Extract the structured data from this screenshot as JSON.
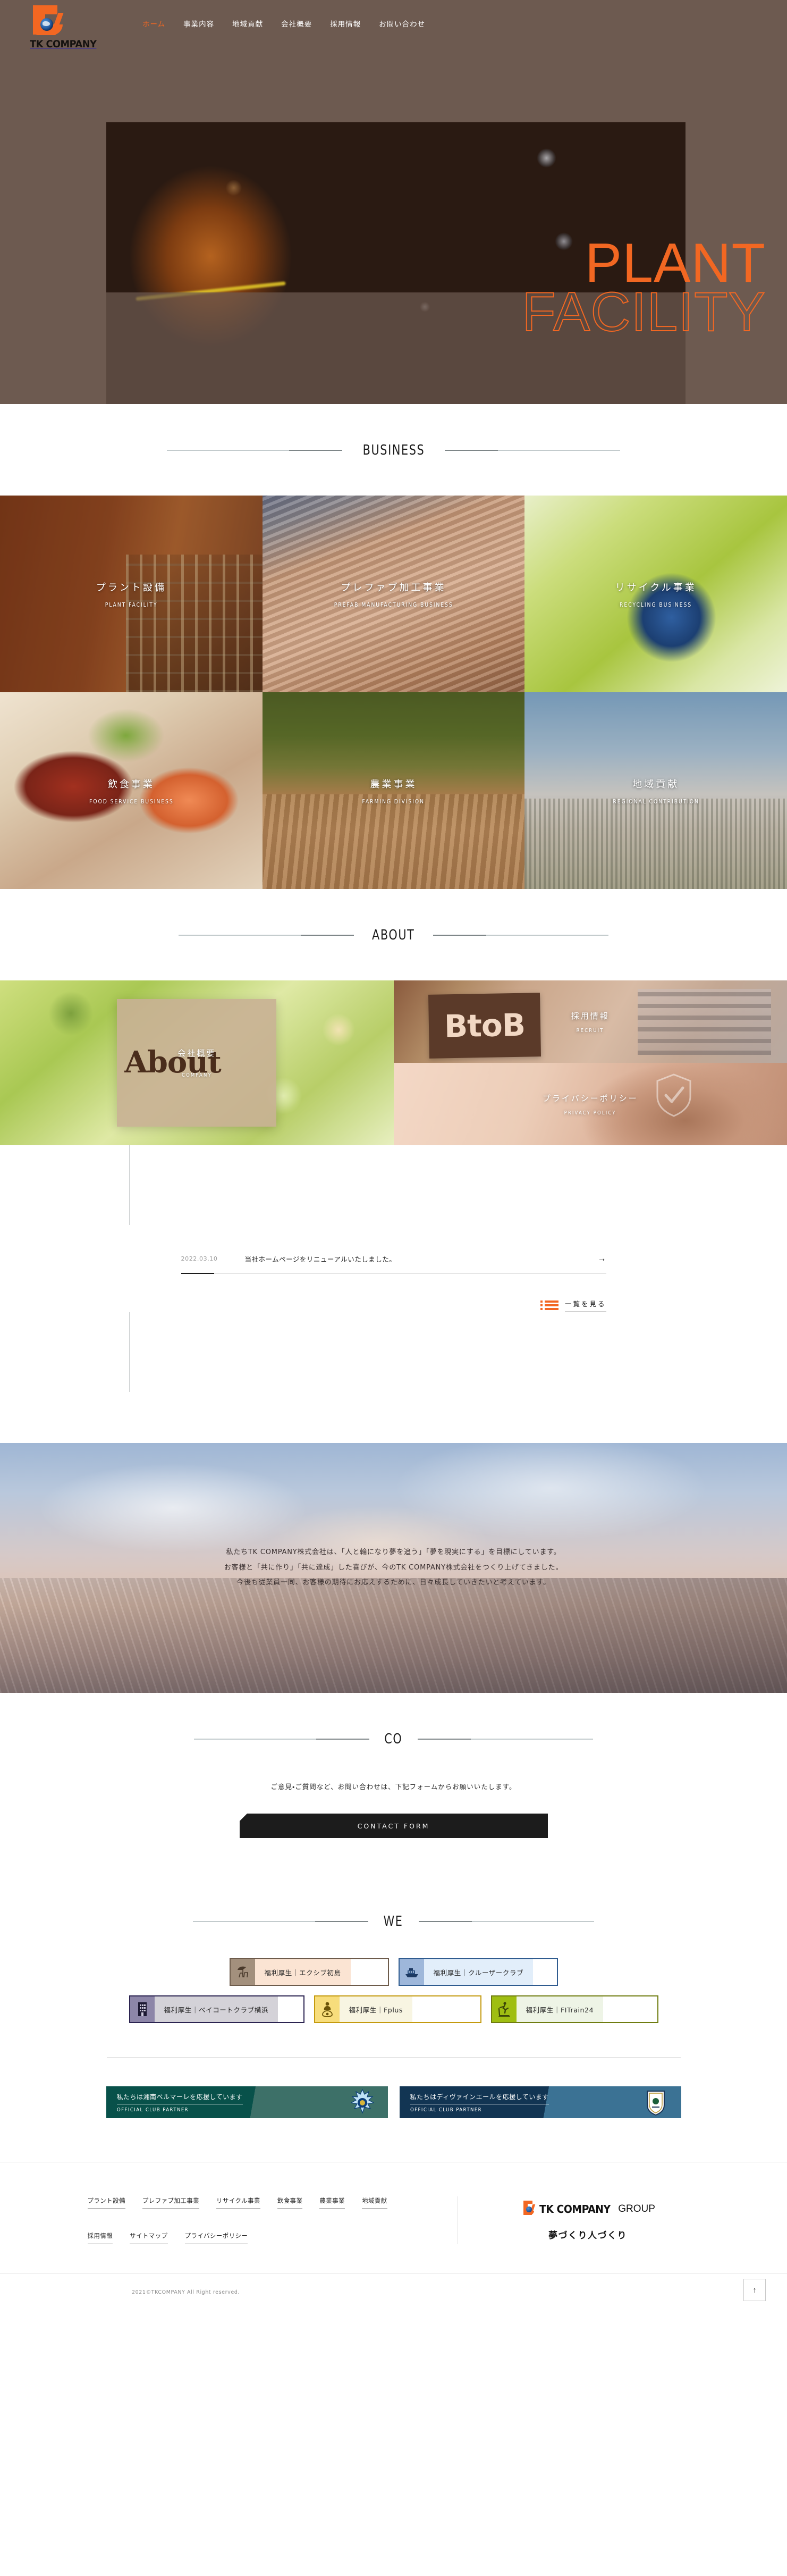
{
  "header": {
    "logo_text": "TK COMPANY",
    "nav": [
      {
        "label": "ホーム",
        "active": true
      },
      {
        "label": "事業内容",
        "active": false
      },
      {
        "label": "地域貢献",
        "active": false
      },
      {
        "label": "会社概要",
        "active": false
      },
      {
        "label": "採用情報",
        "active": false
      },
      {
        "label": "お問い合わせ",
        "active": false
      }
    ]
  },
  "hero": {
    "title_line1": "PLANT",
    "title_line2": "FACILITY"
  },
  "business": {
    "heading": "BUSINESS",
    "tiles": [
      {
        "jp": "プラント設備",
        "en": "PLANT FACILITY"
      },
      {
        "jp": "プレファブ加工事業",
        "en": "PREFAB MANUFACTURING BUSINESS"
      },
      {
        "jp": "リサイクル事業",
        "en": "RECYCLING BUSINESS"
      },
      {
        "jp": "飲食事業",
        "en": "FOOD SERVICE BUSINESS"
      },
      {
        "jp": "農業事業",
        "en": "FARMING DIVISION"
      },
      {
        "jp": "地域貢献",
        "en": "REGIONAL CONTRIBUTION"
      }
    ]
  },
  "about": {
    "heading": "ABOUT",
    "company": {
      "card_word": "About",
      "jp": "会社概要",
      "en": "COMPANY"
    },
    "recruit": {
      "jp": "採用情報",
      "en": "RECRUIT",
      "image_word": "BtoB"
    },
    "privacy": {
      "jp": "プライバシーポリシー",
      "en": "PRIVACY POLICY"
    }
  },
  "news": {
    "items": [
      {
        "date": "2022.03.10",
        "title": "当社ホームページをリニューアルいたしました。",
        "arrow": "→"
      }
    ],
    "more_label": "一覧を見る"
  },
  "philosophy": {
    "lines": [
      "私たちTK COMPANY株式会社は、「人と輪になり夢を追う」「夢を現実にする」を目標にしています。",
      "お客様と「共に作り」「共に達成」した喜びが、今のTK COMPANY株式会社をつくり上げてきました。",
      "今後も従業員一同、お客様の期待にお応えするために、日々成長していきたいと考えています。"
    ]
  },
  "contact": {
    "heading": "CO",
    "lead": "ご意見・ご質問など、お問い合わせは、下記フォームからお願いいたします。",
    "button_label": "CONTACT FORM"
  },
  "welfare": {
    "heading": "WE",
    "row1": [
      {
        "label": "福利厚生｜エクシブ初島",
        "icon": "parasol-chair-icon"
      },
      {
        "label": "福利厚生｜クルーザークラブ",
        "icon": "cruiser-ship-icon"
      }
    ],
    "row2": [
      {
        "label": "福利厚生｜ベイコートクラブ横浜",
        "icon": "building-icon"
      },
      {
        "label": "福利厚生｜Fplus",
        "icon": "spa-person-icon"
      },
      {
        "label": "福利厚生｜FITrain24",
        "icon": "treadmill-icon"
      }
    ]
  },
  "partners": [
    {
      "jp": "私たちは湘南ベルマーレを応援しています",
      "en": "OFFICIAL CLUB PARTNER",
      "emblem": "bellmare-emblem-icon"
    },
    {
      "jp": "私たちはディヴァインエールを応援しています",
      "en": "OFFICIAL CLUB PARTNER",
      "emblem": "divine-ale-emblem-icon"
    }
  ],
  "footer": {
    "links_row1": [
      "プラント設備",
      "プレファブ加工事業",
      "リサイクル事業",
      "飲食事業",
      "農業事業",
      "地域貢献"
    ],
    "links_row2": [
      "採用情報",
      "サイトマップ",
      "プライバシーポリシー"
    ],
    "brand_name": "TK COMPANY",
    "brand_group": "GROUP",
    "tagline": "夢づくり人づくり",
    "copyright": "2021©TKCOMPANY All Right reserved.",
    "to_top": "↑"
  },
  "colors": {
    "accent": "#f26722",
    "header_bg": "#6d5a50",
    "dark": "#1c1c1c"
  }
}
